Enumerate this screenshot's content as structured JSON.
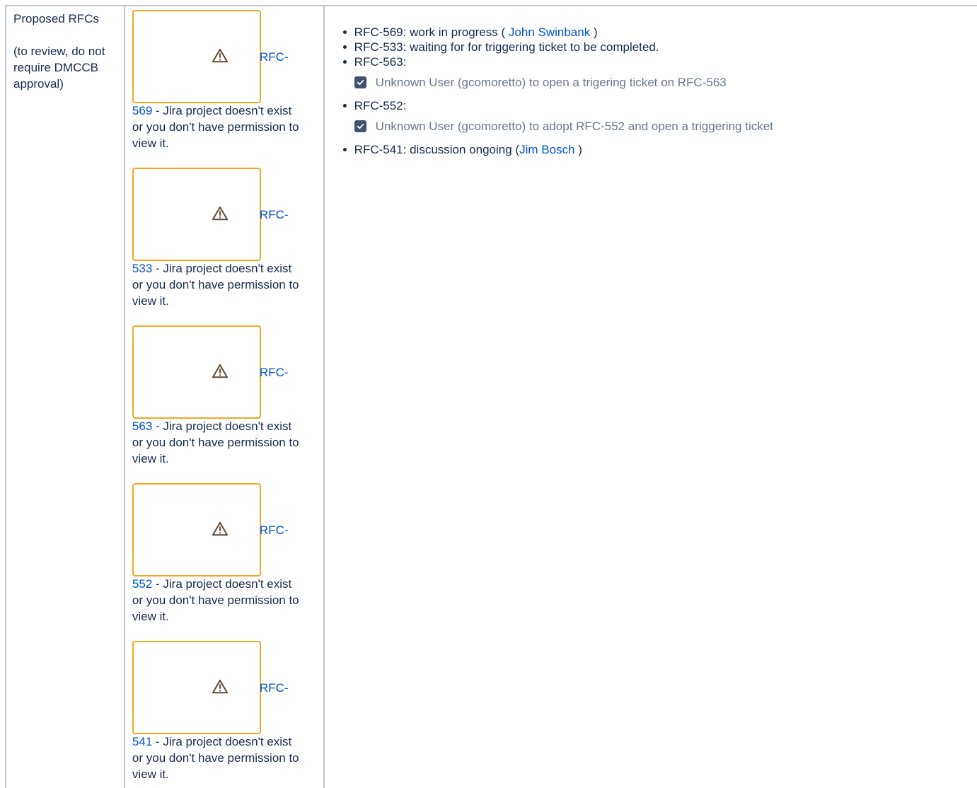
{
  "left_column": {
    "title": "Proposed RFCs",
    "subtitle": "(to review, do not require DMCCB approval)"
  },
  "jira_blocks": [
    {
      "prefix": "RFC-",
      "number": "569",
      "message": " - Jira project doesn't exist or you don't have permission to view it."
    },
    {
      "prefix": "RFC-",
      "number": "533",
      "message": " - Jira project doesn't exist or you don't have permission to view it."
    },
    {
      "prefix": "RFC-",
      "number": "563",
      "message": " - Jira project doesn't exist or you don't have permission to view it."
    },
    {
      "prefix": "RFC-",
      "number": "552",
      "message": " - Jira project doesn't exist or you don't have permission to view it."
    },
    {
      "prefix": "RFC-",
      "number": "541",
      "message": " - Jira project doesn't exist or you don't have permission to view it."
    }
  ],
  "notes": {
    "item1": {
      "pre": "RFC-569: work in progress ( ",
      "link": "John Swinbank",
      "post": " )"
    },
    "item2": {
      "text": "RFC-533: waiting for for triggering ticket to be completed."
    },
    "item3": {
      "text": "RFC-563:"
    },
    "task1": {
      "text": "Unknown User (gcomoretto) to open a trigering ticket on RFC-563"
    },
    "item4": {
      "text": "RFC-552:"
    },
    "task2": {
      "text": "Unknown User (gcomoretto) to adopt RFC-552 and open a triggering ticket"
    },
    "item5": {
      "pre": "RFC-541: discussion ongoing (",
      "link": "Jim Bosch",
      "post": " )"
    }
  },
  "colors": {
    "link": "#0052cc",
    "warning_border": "#f5a623",
    "task_text": "#6b778c",
    "checkbox": "#42526e"
  }
}
